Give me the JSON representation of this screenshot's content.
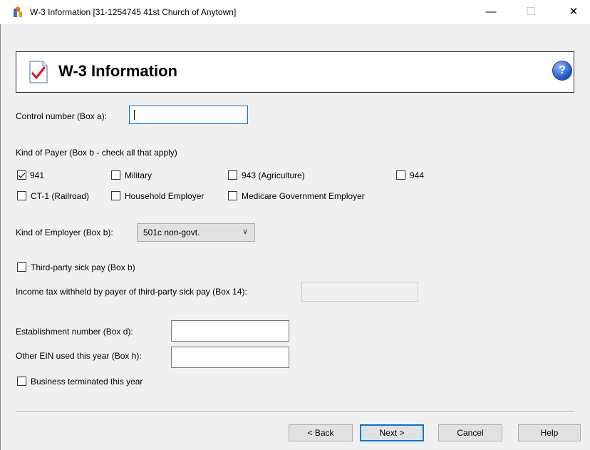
{
  "window": {
    "title": "W-3 Information [31-1254745 41st Church of Anytown]",
    "minimize_glyph": "—",
    "maximize_glyph": "☐",
    "close_glyph": "✕"
  },
  "header": {
    "title": "W-3 Information",
    "help_glyph": "?"
  },
  "control_number": {
    "label": "Control number (Box a):",
    "value": ""
  },
  "kind_of_payer": {
    "label": "Kind of Payer (Box b - check all that apply)",
    "options": [
      {
        "label": "941",
        "checked": true
      },
      {
        "label": "Military",
        "checked": false
      },
      {
        "label": "943 (Agriculture)",
        "checked": false
      },
      {
        "label": "944",
        "checked": false
      },
      {
        "label": "CT-1 (Railroad)",
        "checked": false
      },
      {
        "label": "Household Employer",
        "checked": false
      },
      {
        "label": "Medicare Government Employer",
        "checked": false
      }
    ]
  },
  "kind_of_employer": {
    "label": "Kind of Employer (Box b):",
    "selected": "501c non-govt.",
    "arrow_glyph": "∨"
  },
  "third_party_sick_pay": {
    "label": "Third-party sick pay (Box b)",
    "checked": false
  },
  "income_tax_withheld": {
    "label": "Income tax withheld by payer of third-party sick pay (Box 14):",
    "value": ""
  },
  "establishment_number": {
    "label": "Establishment number (Box d):",
    "value": ""
  },
  "other_ein": {
    "label": "Other EIN used this year (Box h):",
    "value": ""
  },
  "business_terminated": {
    "label": "Business terminated this year",
    "checked": false
  },
  "buttons": {
    "back": "< Back",
    "next": "Next >",
    "cancel": "Cancel",
    "help": "Help"
  },
  "colors": {
    "focus_border": "#0078d7",
    "help_icon": "#1a4fc4",
    "check_red": "#d21f1f"
  }
}
